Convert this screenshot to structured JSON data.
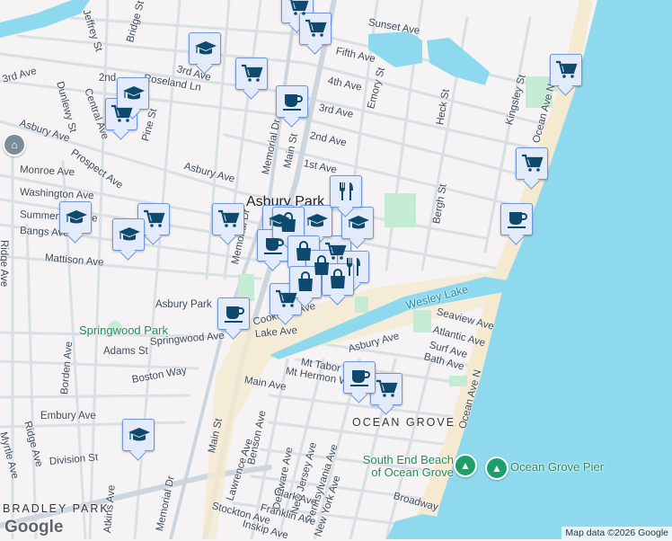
{
  "map": {
    "colors": {
      "land": "#f5f3f3",
      "water": "#8fd9ef",
      "beach": "#f5ead0",
      "park": "#c4ecd2",
      "road": "#d5dde4",
      "marker_fill": "#e3ebfb",
      "marker_border": "#6f97dc",
      "icon": "#0d4a6e"
    },
    "labels": {
      "sunset_ave": "Sunset Ave",
      "fifth_ave": "Fifth Ave",
      "fourth_ave": "4th Ave",
      "third_ave_e": "3rd Ave",
      "second_ave_e": "2nd Ave",
      "first_ave": "1st Ave",
      "emory_st": "Emory St",
      "heck_st": "Heck St",
      "kingsley_st": "Kingsley St",
      "ocean_ave_n_top": "Ocean Ave N",
      "bergh_st": "Bergh St",
      "jeffrey_st": "Jeffrey St",
      "bridge_st": "Bridge St",
      "third_ave_w": "3rd Ave",
      "third_ave_c": "3rd Ave",
      "roseland_ln": "Roseland Ln",
      "second_w": "2nd",
      "central_ave": "Central Ave",
      "dunlewy_st": "Dunlewy St",
      "pine_st": "Pine St",
      "asbury_ave_w": "Asbury Ave",
      "asbury_ave_c": "Asbury Ave",
      "monroe_ave": "Monroe Ave",
      "prospect_ave": "Prospect Ave",
      "washington_ave": "Washington Ave",
      "summerfield_ave": "Summerfield Ave",
      "bangs_ave": "Bangs Ave",
      "mattison_ave": "Mattison Ave",
      "ridge_ave_n": "Ridge Ave",
      "memorial_dr_n": "Memorial Dr",
      "memorial_dr_c": "Memorial Dr",
      "main_st_n": "Main St",
      "main_st_s": "Main St",
      "lake_ave": "Lake Ave",
      "cookman_ave": "Cookman Ave",
      "asbury_park_s": "Asbury Park",
      "springwood_ave": "Springwood Ave",
      "adams_st": "Adams St",
      "boston_way": "Boston Way",
      "embury_ave": "Embury Ave",
      "division_st": "Division St",
      "ridge_ave_s": "Ridge Ave",
      "myrtle_ave": "Myrtle Ave",
      "borden_ave": "Borden Ave",
      "atkins_ave": "Atkins Ave",
      "memorial_dr_s": "Memorial Dr",
      "main_ave": "Main Ave",
      "mt_hermon_way": "Mt Hermon Way",
      "mt_tabor": "Mt Tabor",
      "lawrence_ave": "Lawrence Ave",
      "benson_ave": "Benson Ave",
      "delaware_ave": "Delaware Ave",
      "new_jersey_ave": "New Jersey Ave",
      "pennsylvania_ave": "Pennsylvania Ave",
      "new_york_ave": "New York Ave",
      "clark_ave": "Clark Ave",
      "franklin_ave": "Franklin Ave",
      "stockton_ave": "Stockton Ave",
      "inskip_ave": "Inskip Ave",
      "seaview_ave": "Seaview Ave",
      "atlantic_ave": "Atlantic Ave",
      "surf_ave": "Surf Ave",
      "bath_ave": "Bath Ave",
      "asbury_ave_og": "Asbury Ave",
      "ocean_ave_n_s": "Ocean Ave N",
      "broadway": "Broadway"
    },
    "places": {
      "city": "Asbury Park",
      "springwood_park": "Springwood Park",
      "bradley_park": "BRADLEY PARK",
      "ocean_grove": "OCEAN GROVE",
      "wesley_lake": "Wesley Lake",
      "south_end_beach": "South End Beach of Ocean Grove",
      "ocean_grove_pier": "Ocean Grove Pier"
    },
    "markers": [
      "cart",
      "cart",
      "cart",
      "cart",
      "cart",
      "cart",
      "cart",
      "cart",
      "cart",
      "cart",
      "cart",
      "cap",
      "cap",
      "cap",
      "cap",
      "cap",
      "cap",
      "cap",
      "cap",
      "cup",
      "cup",
      "cup",
      "cup",
      "cup",
      "fork",
      "fork",
      "bag",
      "bag",
      "bag",
      "bag",
      "bag"
    ],
    "attribution": "Map data ©2026 Google",
    "logo": "Google"
  }
}
